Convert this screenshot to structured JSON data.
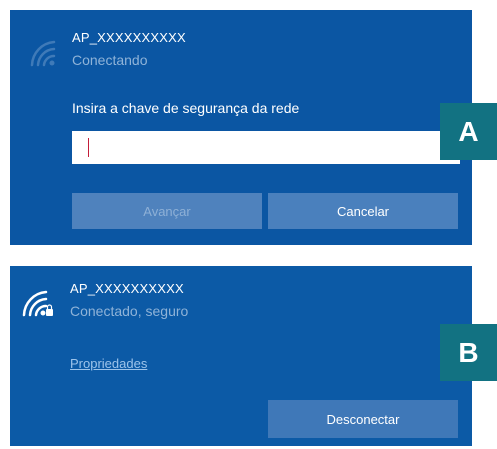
{
  "panel_a": {
    "network_name": "AP_XXXXXXXXXX",
    "status": "Conectando",
    "field_label": "Insira a chave de segurança da rede",
    "key_value": "",
    "next_button": "Avançar",
    "cancel_button": "Cancelar",
    "tag": "A",
    "icon": "wifi-icon"
  },
  "panel_b": {
    "network_name": "AP_XXXXXXXXXX",
    "status": "Conectado, seguro",
    "properties_link": "Propriedades",
    "disconnect_button": "Desconectar",
    "tag": "B",
    "icon": "wifi-secure-icon"
  },
  "colors": {
    "panel_background": "#0b56a3",
    "tag_background": "#127282",
    "button_background": "#4a80bd"
  }
}
